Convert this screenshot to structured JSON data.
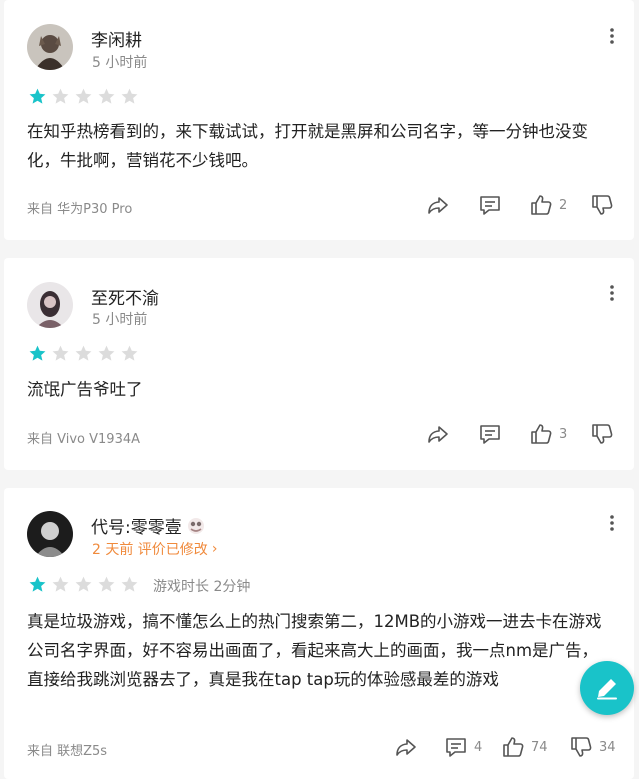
{
  "colors": {
    "accent": "#19c3c9",
    "star_empty": "#dcdcdc",
    "edited": "#f08a3c",
    "muted": "#8a8a8a"
  },
  "reviews": [
    {
      "username": "李闲耕",
      "time": "5 小时前",
      "rating": 1,
      "max_rating": 5,
      "body": "在知乎热榜看到的，来下载试试，打开就是黑屏和公司名字，等一分钟也没变化，牛批啊，营销花不少钱吧。",
      "device": "来自 华为P30 Pro",
      "comment_count": "",
      "like_count": "2",
      "dislike_count": ""
    },
    {
      "username": "至死不渝",
      "time": "5 小时前",
      "rating": 1,
      "max_rating": 5,
      "body": "流氓广告爷吐了",
      "device": "来自 Vivo V1934A",
      "comment_count": "",
      "like_count": "3",
      "dislike_count": ""
    },
    {
      "username": "代号:零零壹",
      "time": "2 天前 评价已修改",
      "rating": 1,
      "max_rating": 5,
      "playtime": "游戏时长 2分钟",
      "body": "真是垃圾游戏，搞不懂怎么上的热门搜索第二，12MB的小游戏一进去卡在游戏公司名字界面，好不容易出画面了，看起来高大上的画面，我一点nm是广告，直接给我跳浏览器去了，真是我在tap tap玩的体验感最差的游戏",
      "device": "来自 联想Z5s",
      "comment_count": "4",
      "like_count": "74",
      "dislike_count": "34"
    }
  ],
  "icons": {
    "share": "share-icon",
    "comment": "comment-icon",
    "like": "thumbs-up-icon",
    "dislike": "thumbs-down-icon",
    "more": "more-vertical-icon",
    "write": "write-review-icon",
    "badge": "user-badge-icon"
  }
}
